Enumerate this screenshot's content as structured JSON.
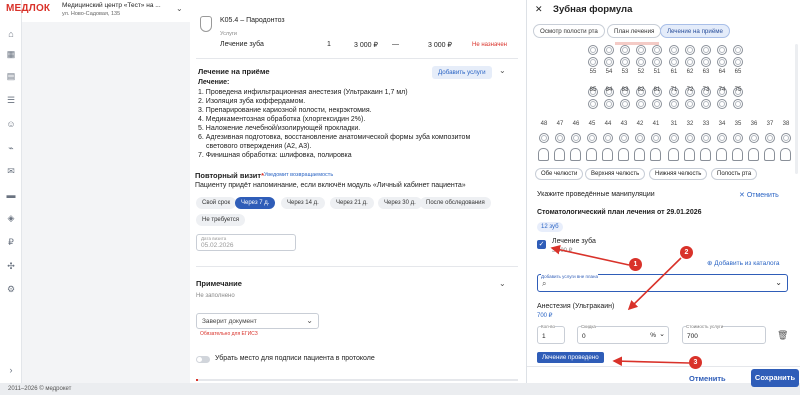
{
  "header": {
    "logo": "МЕДЛОК",
    "clinic": "Медицинский центр «Тест» на ...",
    "address": "ул. Ново-Садовая, 135"
  },
  "footer": {
    "copyright": "2011–2026 © медрокет"
  },
  "services": {
    "diagnosis": "K05.4 – Пародонтоз",
    "section_label": "Услуги",
    "row": {
      "name": "Лечение зуба",
      "qty": "1",
      "price": "3 000 ₽",
      "dash": "—",
      "total": "3 000 ₽",
      "status": "Не назначен"
    }
  },
  "treatment": {
    "title": "Лечение на приёме",
    "add_btn": "Добавить услуги",
    "subtitle": "Лечение:",
    "steps": [
      "1. Проведена инфильтрационная анестезия (Ультракаин 1,7 мл)",
      "2. Изоляция зуба коффердамом.",
      "3. Препарирование кариозной полости, некрэктомия.",
      "4. Медикаментозная обработка (хлоргексидин 2%).",
      "5. Наложение лечебной/изолирующей прокладки.",
      "6. Адгезивная подготовка, восстановление анатомической формы зуба композитом",
      "светового отверждения (A2, A3).",
      "7. Финишная обработка: шлифовка, полировка"
    ]
  },
  "revisit": {
    "title": "Повторный визит",
    "star": "*",
    "notify": "Уведомит возвращаемость",
    "hint": "Пациенту придёт напоминание, если включён модуль «Личный кабинет пациента»",
    "options": [
      "Свой срок",
      "Через 7 д.",
      "Через 14 д.",
      "Через 21 д.",
      "Через 30 д.",
      "После обследования"
    ],
    "option_extra": "Не требуется",
    "date_label": "Дата визита",
    "date_value": "05.02.2026"
  },
  "note": {
    "title": "Примечание",
    "value": "Не заполнено",
    "doc_placeholder": "Заверит документ",
    "doc_hint": "Обязательно для ЕГИСЗ",
    "toggle_label": "Убрать место для подписи пациента в протоколе"
  },
  "panel": {
    "title": "Зубная формула",
    "tabs": [
      "Осмотр полости рта",
      "План лечения",
      "Лечение на приёме"
    ],
    "upper_row": [
      "55",
      "54",
      "53",
      "52",
      "51",
      "61",
      "62",
      "63",
      "64",
      "65"
    ],
    "lower_primary": [
      "85",
      "84",
      "83",
      "82",
      "81",
      "71",
      "72",
      "73",
      "74",
      "75"
    ],
    "lower_perm": [
      "48",
      "47",
      "46",
      "45",
      "44",
      "43",
      "42",
      "41",
      "31",
      "32",
      "33",
      "34",
      "35",
      "36",
      "37",
      "38"
    ],
    "jaw_buttons": [
      "Обе челюсти",
      "Верхняя челюсть",
      "Нижняя челюсть",
      "Полость рта"
    ],
    "manip_title": "Укажите проведённые манипуляции",
    "cancel_link": "Отменить",
    "plan_title": "Стоматологический план лечения от 29.01.2026",
    "tooth_chip": "12 зуб",
    "service_name": "Лечение зуба",
    "service_price": "3 000 ₽",
    "add_from_catalog": "Добавить из каталога",
    "extra_label": "Добавить услуги вне плана",
    "anesthesia_name": "Анестезия (Ультракаин)",
    "anesthesia_price": "700 ₽",
    "qty_label": "Кол-во",
    "qty_value": "1",
    "discount_label": "Скидка",
    "discount_value": "0",
    "discount_unit": "%",
    "cost_label": "Стоимость услуги",
    "cost_value": "700",
    "done_btn": "Лечение проведено",
    "cancel_btn": "Отменить",
    "save_btn": "Сохранить"
  },
  "annotations": [
    "1",
    "2",
    "3"
  ],
  "colors": {
    "primary": "#2f5db8",
    "accent_red": "#d9322a"
  }
}
